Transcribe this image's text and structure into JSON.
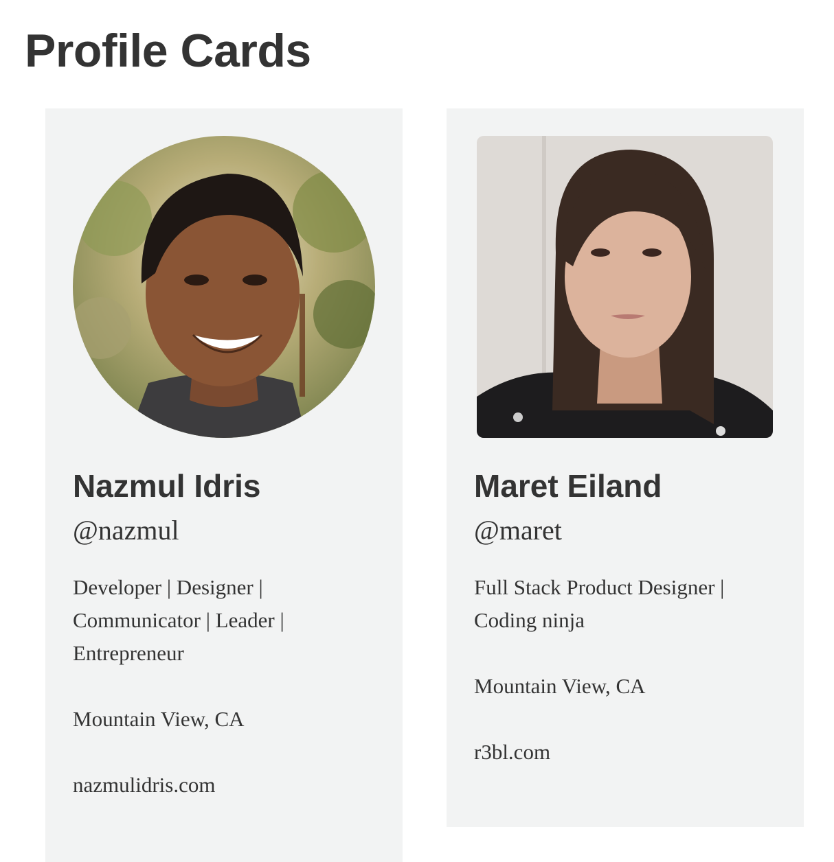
{
  "page": {
    "title": "Profile Cards"
  },
  "cards": [
    {
      "avatar_desc": "portrait-photo",
      "avatar_shape": "circle",
      "name": "Nazmul Idris",
      "handle": "@nazmul",
      "bio": "Developer | Designer | Communicator | Leader | Entrepreneur",
      "location": "Mountain View, CA",
      "website": "nazmulidris.com"
    },
    {
      "avatar_desc": "portrait-photo",
      "avatar_shape": "rounded-rectangle",
      "name": "Maret Eiland",
      "handle": "@maret",
      "bio": "Full Stack Product Designer | Coding ninja",
      "location": "Mountain View, CA",
      "website": "r3bl.com"
    }
  ],
  "colors": {
    "page_background": "#ffffff",
    "card_background": "#f2f3f3",
    "text": "#333333"
  }
}
